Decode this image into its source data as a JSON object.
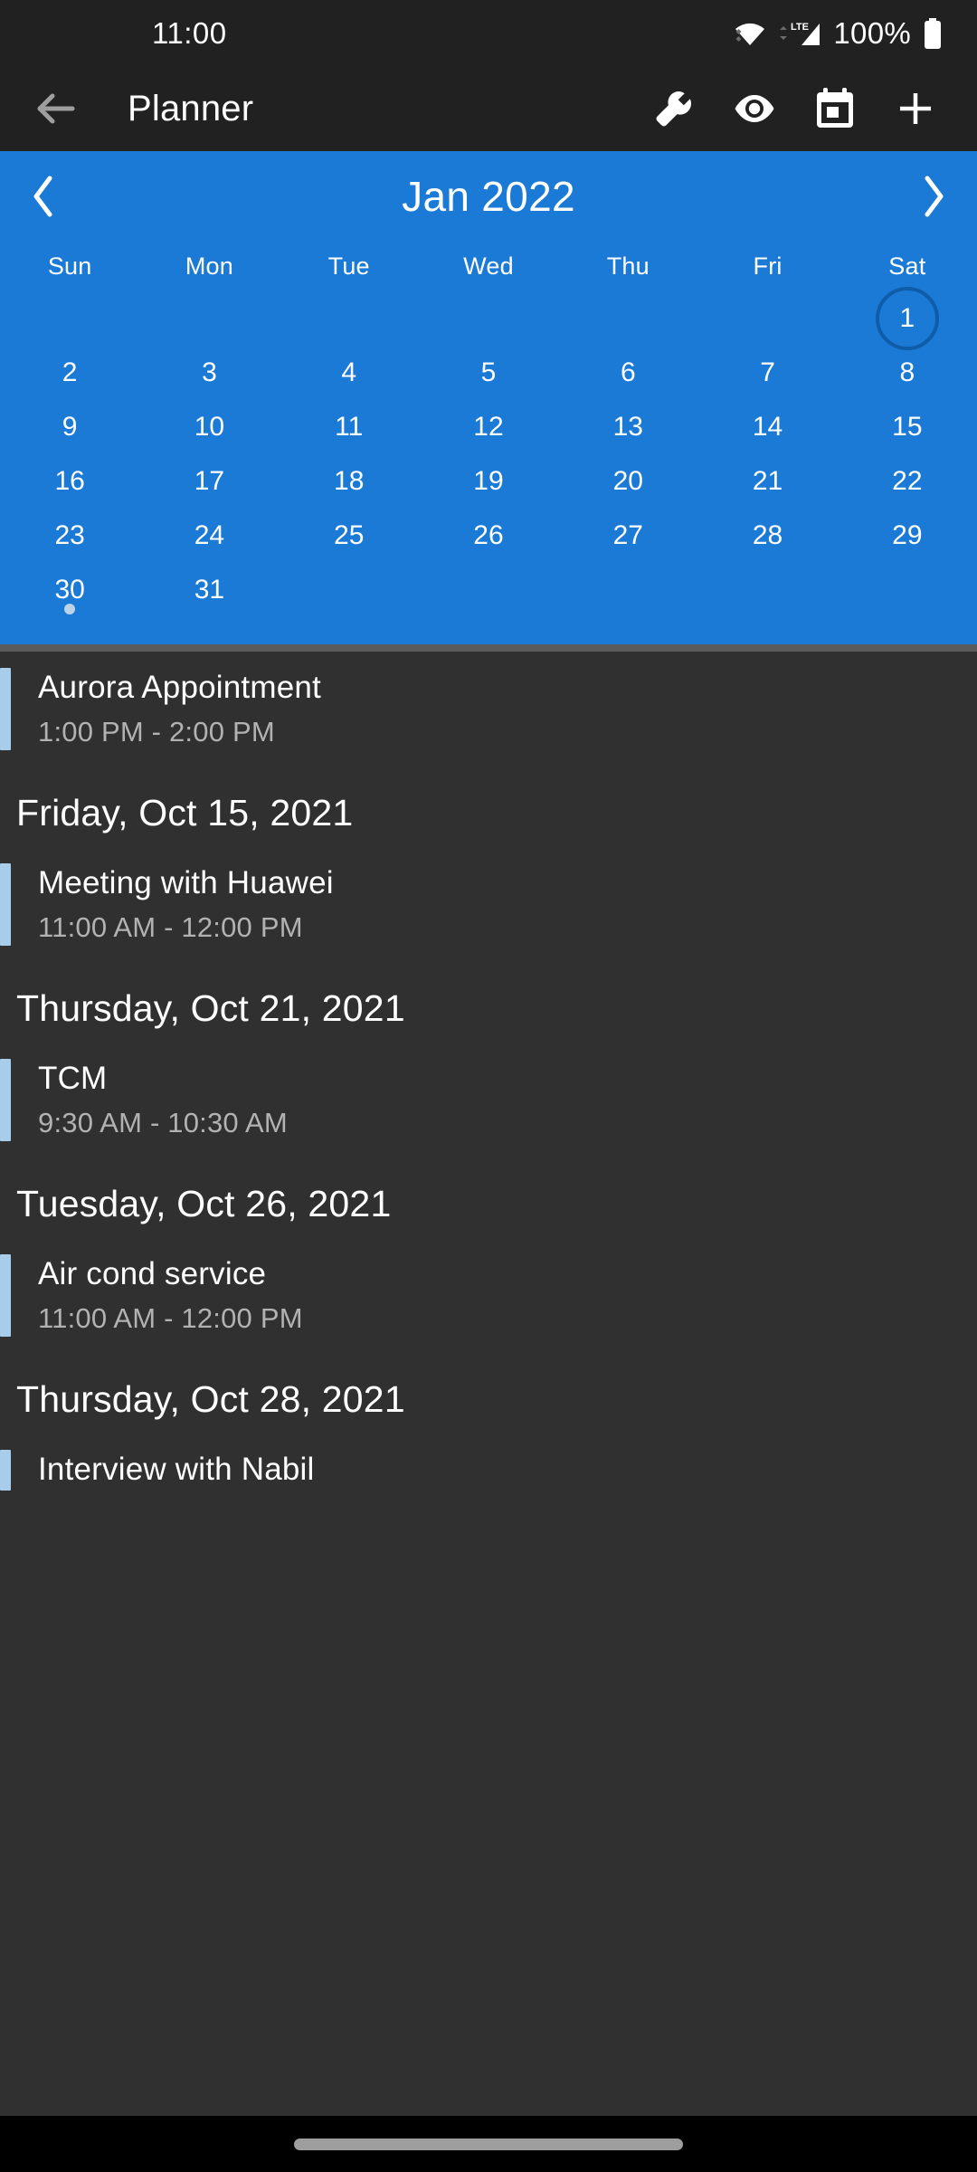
{
  "status_bar": {
    "time": "11:00",
    "battery_percent": "100%",
    "icons": [
      "wifi-icon",
      "lte-signal-icon",
      "battery-icon"
    ],
    "network_label": "LTE"
  },
  "toolbar": {
    "back_label": "back-arrow",
    "title": "Planner",
    "actions": [
      {
        "name": "settings-wrench-button",
        "label": "Settings"
      },
      {
        "name": "view-eye-button",
        "label": "View"
      },
      {
        "name": "go-to-today-button",
        "label": "Today"
      },
      {
        "name": "add-event-button",
        "label": "Add"
      }
    ]
  },
  "calendar": {
    "month_label": "Jan 2022",
    "prev_label": "‹",
    "next_label": "›",
    "accent_color": "#1b7ad6",
    "today_ring_color": "#0f5ca8",
    "event_dot_color": "#bcd3e8",
    "day_names": [
      "Sun",
      "Mon",
      "Tue",
      "Wed",
      "Thu",
      "Fri",
      "Sat"
    ],
    "leading_blanks": 6,
    "days": [
      {
        "n": "1",
        "today": true,
        "dot": false
      },
      {
        "n": "2",
        "today": false,
        "dot": false
      },
      {
        "n": "3",
        "today": false,
        "dot": false
      },
      {
        "n": "4",
        "today": false,
        "dot": false
      },
      {
        "n": "5",
        "today": false,
        "dot": false
      },
      {
        "n": "6",
        "today": false,
        "dot": false
      },
      {
        "n": "7",
        "today": false,
        "dot": false
      },
      {
        "n": "8",
        "today": false,
        "dot": false
      },
      {
        "n": "9",
        "today": false,
        "dot": false
      },
      {
        "n": "10",
        "today": false,
        "dot": false
      },
      {
        "n": "11",
        "today": false,
        "dot": false
      },
      {
        "n": "12",
        "today": false,
        "dot": false
      },
      {
        "n": "13",
        "today": false,
        "dot": false
      },
      {
        "n": "14",
        "today": false,
        "dot": false
      },
      {
        "n": "15",
        "today": false,
        "dot": false
      },
      {
        "n": "16",
        "today": false,
        "dot": false
      },
      {
        "n": "17",
        "today": false,
        "dot": false
      },
      {
        "n": "18",
        "today": false,
        "dot": false
      },
      {
        "n": "19",
        "today": false,
        "dot": false
      },
      {
        "n": "20",
        "today": false,
        "dot": false
      },
      {
        "n": "21",
        "today": false,
        "dot": false
      },
      {
        "n": "22",
        "today": false,
        "dot": false
      },
      {
        "n": "23",
        "today": false,
        "dot": false
      },
      {
        "n": "24",
        "today": false,
        "dot": false
      },
      {
        "n": "25",
        "today": false,
        "dot": false
      },
      {
        "n": "26",
        "today": false,
        "dot": false
      },
      {
        "n": "27",
        "today": false,
        "dot": false
      },
      {
        "n": "28",
        "today": false,
        "dot": false
      },
      {
        "n": "29",
        "today": false,
        "dot": false
      },
      {
        "n": "30",
        "today": false,
        "dot": true
      },
      {
        "n": "31",
        "today": false,
        "dot": false
      }
    ]
  },
  "agenda": {
    "event_accent_color": "#a8cdea",
    "items": [
      {
        "kind": "event",
        "title": "Aurora Appointment",
        "time": "1:00 PM - 2:00 PM"
      },
      {
        "kind": "header",
        "title": "Friday, Oct 15, 2021"
      },
      {
        "kind": "event",
        "title": "Meeting with Huawei",
        "time": "11:00 AM - 12:00 PM"
      },
      {
        "kind": "header",
        "title": "Thursday, Oct 21, 2021"
      },
      {
        "kind": "event",
        "title": "TCM",
        "time": "9:30 AM - 10:30 AM"
      },
      {
        "kind": "header",
        "title": "Tuesday, Oct 26, 2021"
      },
      {
        "kind": "event",
        "title": "Air cond service",
        "time": "11:00 AM - 12:00 PM"
      },
      {
        "kind": "header",
        "title": "Thursday, Oct 28, 2021"
      },
      {
        "kind": "event",
        "title": "Interview with Nabil",
        "time": ""
      }
    ]
  },
  "nav_bar": {
    "gesture_pill": "home-gesture-pill"
  }
}
